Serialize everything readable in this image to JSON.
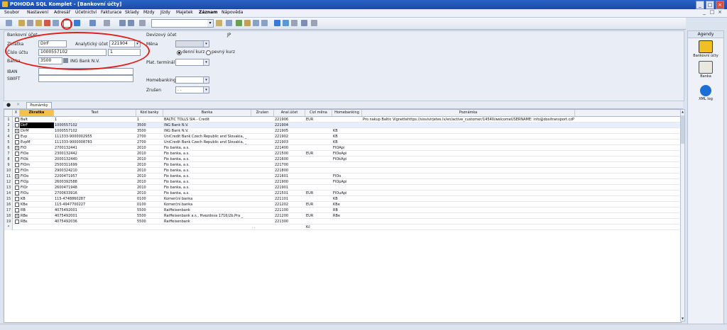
{
  "window": {
    "title": "POHODA SQL Komplet - [Bankovní účty]",
    "controls": [
      "_",
      "□",
      "×"
    ],
    "mdi_controls": [
      "_",
      "□",
      "×"
    ]
  },
  "menu": [
    "Soubor",
    "Nastavení",
    "Adresář",
    "Účetnictví",
    "Fakturace",
    "Sklady",
    "Mzdy",
    "Jízdy",
    "Majetek",
    "Záznam",
    "Nápověda"
  ],
  "toolbar": {
    "filter_value": "",
    "dropdown_arrow": "▾"
  },
  "form": {
    "section_label": "Bankovní účet",
    "zkratka_label": "Zkratka",
    "zkratka_value": "DirF",
    "analyticky_label": "Analytický účet",
    "analyticky_value": "221904",
    "cislo_uctu_label": "Číslo účtu",
    "cislo_uctu_value": "1000557102",
    "cislo_uctu_suffix": "1",
    "banka_label": "Banka",
    "banka_code": "3500",
    "banka_name": "ING Bank N.V.",
    "iban_label": "IBAN",
    "swift_label": "SWIFT",
    "devizovy_label": "Devizový účet",
    "jp_label": "JP",
    "mena_label": "Měna",
    "denni_kurz_label": "denní kurz",
    "pevny_kurz_label": "pevný kurz",
    "plat_terminal_label": "Plat. terminál",
    "homebanking_label": "Homebanking",
    "zruseni_label": "Zrušen",
    "zruseni_value": ". ."
  },
  "tabs": {
    "poznamky": "Poznámky"
  },
  "grid": {
    "headers": [
      "X",
      "Zkratka",
      "Text",
      "Kód banky",
      "Banka",
      "Zrušen",
      "Anal.účet",
      "Cizí měna",
      "Homebanking",
      "Poznámka"
    ],
    "rows": [
      {
        "n": "1",
        "chk": "",
        "zk": "BaIt",
        "text": "1",
        "kod": "1",
        "banka": "BALTIC TOLLS SIA - Credit",
        "zr": "",
        "anal": "221906",
        "cm": "EUR",
        "hb": "",
        "pozn": "Pro nakup Baltic Vignettehttps://sisvivirjetes.lv/en/active_customer/14540/welcomeUSERNAME: info@dositransport.czP"
      },
      {
        "n": "2",
        "chk": "",
        "zk": "DirF",
        "text": "1000557102",
        "kod": "3500",
        "banka": "ING Bank N.V.",
        "zr": "",
        "anal": "221904",
        "cm": "",
        "hb": "",
        "pozn": ""
      },
      {
        "n": "3",
        "chk": "x",
        "zk": "DirM",
        "text": "1000557102",
        "kod": "3500",
        "banka": "ING Bank N.V.",
        "zr": "",
        "anal": "221905",
        "cm": "",
        "hb": "KB",
        "pozn": ""
      },
      {
        "n": "4",
        "chk": "",
        "zk": "Evp",
        "text": "111333-9000002955",
        "kod": "2700",
        "banka": "UniCredit Bank Czech Republic and Slovakia, _",
        "zr": "",
        "anal": "221902",
        "cm": "",
        "hb": "KB",
        "pozn": ""
      },
      {
        "n": "5",
        "chk": "",
        "zk": "EvpM",
        "text": "111333-9000008783",
        "kod": "2700",
        "banka": "UniCredit Bank Czech Republic and Slovakia, _",
        "zr": "",
        "anal": "221903",
        "cm": "",
        "hb": "KB",
        "pozn": ""
      },
      {
        "n": "6",
        "chk": "x",
        "zk": "FIO",
        "text": "2700132441",
        "kod": "2010",
        "banka": "Fio banka, a.s.",
        "zr": "",
        "anal": "221400",
        "cm": "",
        "hb": "FIOApi",
        "pozn": ""
      },
      {
        "n": "7",
        "chk": "",
        "zk": "FIOe",
        "text": "2300132442",
        "kod": "2010",
        "banka": "Fio banka, a.s.",
        "zr": "",
        "anal": "221500",
        "cm": "EUR",
        "hb": "FIOeApi",
        "pozn": ""
      },
      {
        "n": "8",
        "chk": "",
        "zk": "FIOk",
        "text": "2000132440",
        "kod": "2010",
        "banka": "Fio banka, a.s.",
        "zr": "",
        "anal": "221600",
        "cm": "",
        "hb": "FIOkApi",
        "pozn": ""
      },
      {
        "n": "9",
        "chk": "",
        "zk": "FIOm",
        "text": "2500311699",
        "kod": "2010",
        "banka": "Fio banka, a.s.",
        "zr": "",
        "anal": "221700",
        "cm": "",
        "hb": "",
        "pozn": ""
      },
      {
        "n": "10",
        "chk": "",
        "zk": "FIOn",
        "text": "2900324210",
        "kod": "2010",
        "banka": "Fio banka, a.s.",
        "zr": "",
        "anal": "221800",
        "cm": "",
        "hb": "",
        "pozn": ""
      },
      {
        "n": "11",
        "chk": "x",
        "zk": "FIOo",
        "text": "2200471957",
        "kod": "2010",
        "banka": "Fio banka, a.s.",
        "zr": "",
        "anal": "221601",
        "cm": "",
        "hb": "FIOo",
        "pozn": ""
      },
      {
        "n": "12",
        "chk": "",
        "zk": "FIOp",
        "text": "2600392588",
        "kod": "2010",
        "banka": "Fio banka, a.s.",
        "zr": "",
        "anal": "221900",
        "cm": "",
        "hb": "FIOpApi",
        "pozn": ""
      },
      {
        "n": "13",
        "chk": "",
        "zk": "FIOr",
        "text": "2600471948",
        "kod": "2010",
        "banka": "Fio banka, a.s.",
        "zr": "",
        "anal": "221901",
        "cm": "",
        "hb": "",
        "pozn": ""
      },
      {
        "n": "14",
        "chk": "",
        "zk": "FIOu",
        "text": "2700633916",
        "kod": "2010",
        "banka": "Fio banka, a.s.",
        "zr": "",
        "anal": "221501",
        "cm": "EUR",
        "hb": "FIOuApi",
        "pozn": ""
      },
      {
        "n": "15",
        "chk": "",
        "zk": "KB",
        "text": "115-4748860287",
        "kod": "0100",
        "banka": "Komerční banka",
        "zr": "",
        "anal": "221101",
        "cm": "",
        "hb": "KB",
        "pozn": ""
      },
      {
        "n": "16",
        "chk": "",
        "zk": "KBe",
        "text": "115-4947700227",
        "kod": "0100",
        "banka": "Komerční banka",
        "zr": "",
        "anal": "221202",
        "cm": "EUR",
        "hb": "KBe",
        "pozn": ""
      },
      {
        "n": "17",
        "chk": "",
        "zk": "RB",
        "text": "4075492001",
        "kod": "5500",
        "banka": "Raiffeisenbank",
        "zr": "",
        "anal": "221100",
        "cm": "",
        "hb": "RB",
        "pozn": ""
      },
      {
        "n": "18",
        "chk": "x",
        "zk": "RBe",
        "text": "4075492001",
        "kod": "5500",
        "banka": "Raiffeisenbank a.s., Hvezdova 1716/2b,Pra _",
        "zr": "",
        "anal": "221200",
        "cm": "EUR",
        "hb": "RBe",
        "pozn": ""
      },
      {
        "n": "19",
        "chk": "",
        "zk": "RBs",
        "text": "4075492036",
        "kod": "5500",
        "banka": "Raiffeisenbank",
        "zr": "",
        "anal": "221300",
        "cm": "",
        "hb": "",
        "pozn": ""
      },
      {
        "n": "*",
        "chk": "",
        "zk": "",
        "text": "",
        "kod": "",
        "banka": "",
        "zr": ". .",
        "anal": "",
        "cm": "Kč",
        "hb": "",
        "pozn": ""
      }
    ]
  },
  "agenda": {
    "title": "Agendy",
    "items": [
      "Bankovní účty",
      "Banka",
      "XML log"
    ]
  },
  "colors": {
    "accent": "#2a62c8",
    "highlight": "#f4c24a",
    "annotation": "#e0211b"
  }
}
